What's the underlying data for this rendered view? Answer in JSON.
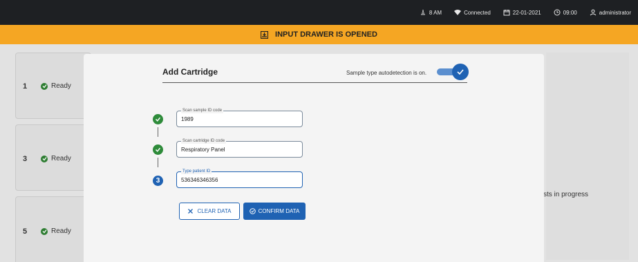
{
  "statusbar": {
    "temperature": "8 AM",
    "connection": "Connected",
    "date": "22-01-2021",
    "time": "09:00",
    "user": "administrator"
  },
  "banner": {
    "text": "INPUT DRAWER IS OPENED"
  },
  "background": {
    "slots": [
      {
        "number": "1",
        "status": "Ready"
      },
      {
        "number": "3",
        "status": "Ready"
      },
      {
        "number": "5",
        "status": "Ready"
      }
    ],
    "right_text": "sts in progress"
  },
  "modal": {
    "title": "Add Cartridge",
    "autodetect_label": "Sample type autodetection is on.",
    "autodetect_on": true,
    "steps": [
      {
        "legend": "Scan sample ID code",
        "value": "1989",
        "state": "done"
      },
      {
        "legend": "Scan cartridge ID code",
        "value": "Respiratory Panel",
        "state": "done"
      },
      {
        "legend": "Type patient ID",
        "value": "536346346356",
        "state": "active",
        "number": "3"
      }
    ],
    "clear_label": "CLEAR DATA",
    "confirm_label": "CONFIRM DATA"
  },
  "colors": {
    "banner": "#f5a623",
    "primary": "#1f62b3",
    "success": "#2e8b3a",
    "topbar": "#1e2023"
  }
}
